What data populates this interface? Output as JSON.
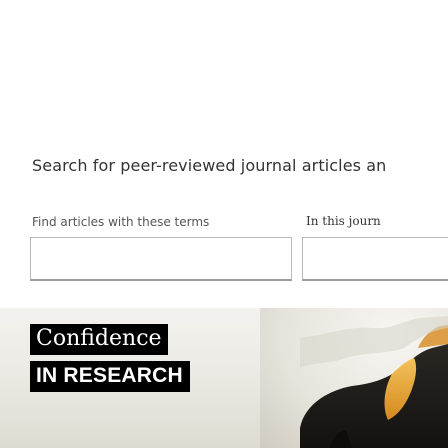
{
  "search": {
    "heading": "Search for peer-reviewed journal articles an",
    "terms_label": "Find articles with these terms",
    "terms_value": "",
    "journal_label": "In this journ",
    "journal_value": ""
  },
  "banner": {
    "line1": "Confidence",
    "line2": "IN RESEARCH"
  },
  "colors": {
    "banner_text_bg": "#000000",
    "banner_text": "#ffffff",
    "accent_orange": "#e8a92e"
  }
}
